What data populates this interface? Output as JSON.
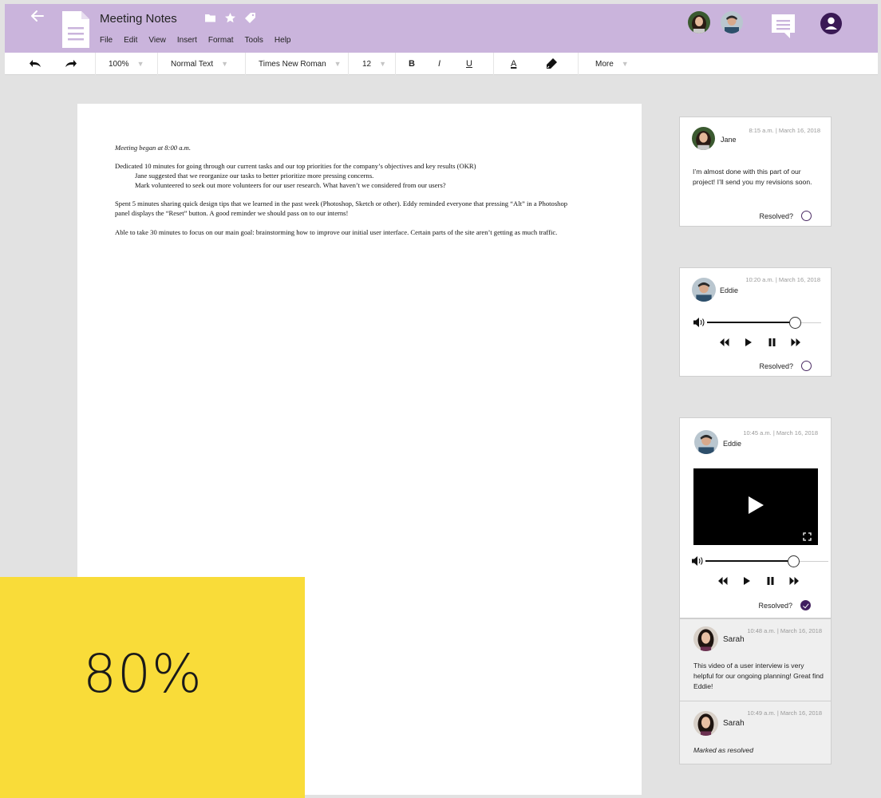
{
  "header": {
    "title": "Meeting Notes",
    "menu": [
      "File",
      "Edit",
      "View",
      "Insert",
      "Format",
      "Tools",
      "Help"
    ],
    "title_icons": [
      "folder-icon",
      "star-icon",
      "tag-icon"
    ],
    "accent_color": "#cab4dc"
  },
  "toolbar": {
    "zoom": "100%",
    "style": "Normal Text",
    "font": "Times New Roman",
    "size": "12",
    "bold": "B",
    "italic": "I",
    "underline": "U",
    "text_color": "A",
    "more": "More"
  },
  "document": {
    "line1": "Meeting began at 8:00 a.m.",
    "line2": "Dedicated 10 minutes for going through our current tasks and our top priorities for the company’s objectives and key results (OKR)",
    "line3": "Jane suggested that we reorganize our tasks to better prioritize more pressing concerns.",
    "line4": "Mark volunteered to seek out more volunteers for our user research. What haven’t we considered from our users?",
    "line5": "Spent 5 minutes sharing quick design tips that we learned in the past week (Photoshop, Sketch or other). Eddy reminded everyone that pressing “Alt” in a Photoshop",
    "line6": "panel displays the “Reset” button. A good reminder we should pass on to our interns!",
    "line7": "Able to take 30 minutes to focus on our main goal: brainstorming how to improve our initial user interface. Certain parts of the site aren’t getting as much traffic."
  },
  "comments": {
    "c1": {
      "time": "8:15 a.m. | March 16, 2018",
      "name": "Jane",
      "text": "I’m almost done with this part of our project! I’ll send you my revisions soon.",
      "resolved_label": "Resolved?",
      "resolved": false
    },
    "c2": {
      "time": "10:20 a.m. | March 16, 2018",
      "name": "Eddie",
      "resolved_label": "Resolved?",
      "resolved": false,
      "audio_progress": 0.81
    },
    "c3": {
      "time": "10:45 a.m. | March 16, 2018",
      "name": "Eddie",
      "resolved_label": "Resolved?",
      "resolved": true,
      "audio_progress": 0.83
    },
    "r1": {
      "time": "10:48 a.m. | March 16, 2018",
      "name": "Sarah",
      "text": "This video of a user interview is very helpful for our ongoing planning! Great find Eddie!"
    },
    "r2": {
      "time": "10:49 a.m. | March 16, 2018",
      "name": "Sarah",
      "text": "Marked as resolved"
    }
  },
  "overlay": {
    "percent": "80%",
    "color": "#f9dc39"
  }
}
